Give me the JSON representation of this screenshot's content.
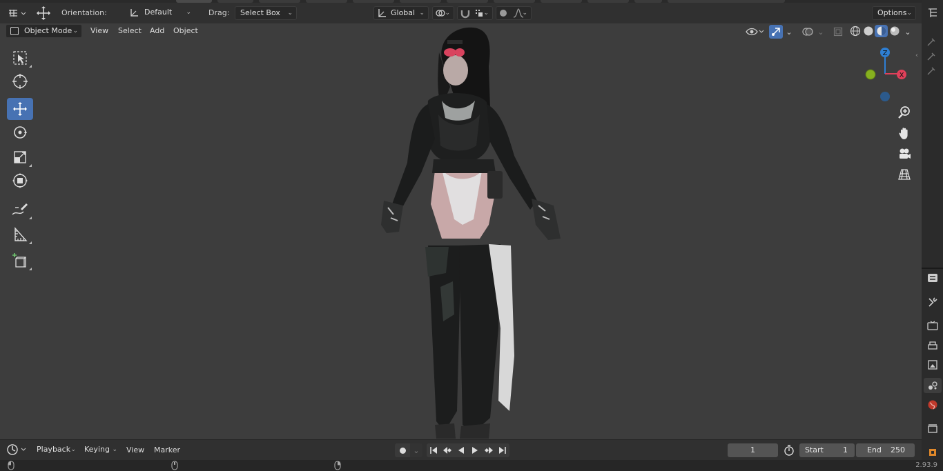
{
  "header": {
    "orientation_label": "Orientation:",
    "orientation_value": "Default",
    "drag_label": "Drag:",
    "drag_value": "Select Box",
    "transform_space": "Global",
    "options_label": "Options"
  },
  "viewport_menu": {
    "mode": "Object Mode",
    "items": [
      "View",
      "Select",
      "Add",
      "Object"
    ]
  },
  "tools": [
    {
      "name": "select-box-tool",
      "icon": "select-box-icon",
      "active": false
    },
    {
      "name": "cursor-tool",
      "icon": "cursor-icon",
      "active": false
    },
    {
      "name": "move-tool",
      "icon": "move-icon",
      "active": true
    },
    {
      "name": "rotate-tool",
      "icon": "rotate-icon",
      "active": false
    },
    {
      "name": "scale-tool",
      "icon": "scale-icon",
      "active": false
    },
    {
      "name": "transform-tool",
      "icon": "transform-icon",
      "active": false
    },
    {
      "name": "annotate-tool",
      "icon": "annotate-icon",
      "active": false
    },
    {
      "name": "measure-tool",
      "icon": "measure-icon",
      "active": false
    },
    {
      "name": "add-cube-tool",
      "icon": "add-cube-icon",
      "active": false
    }
  ],
  "gizmo": {
    "z_label": "Z",
    "x_label": "X",
    "colors": {
      "z": "#2e7fd4",
      "x": "#e0405a",
      "y": "#86b01f",
      "neg_z": "#2c5a8c"
    }
  },
  "timeline": {
    "menu": [
      "Playback",
      "Keying",
      "View",
      "Marker"
    ],
    "current_frame": "1",
    "start_label": "Start",
    "start_value": "1",
    "end_label": "End",
    "end_value": "250"
  },
  "status": {
    "version": "2.93.9"
  },
  "colors": {
    "accent": "#4772b3",
    "viewport_bg": "#3d3d3d",
    "header_bg": "#303030"
  }
}
